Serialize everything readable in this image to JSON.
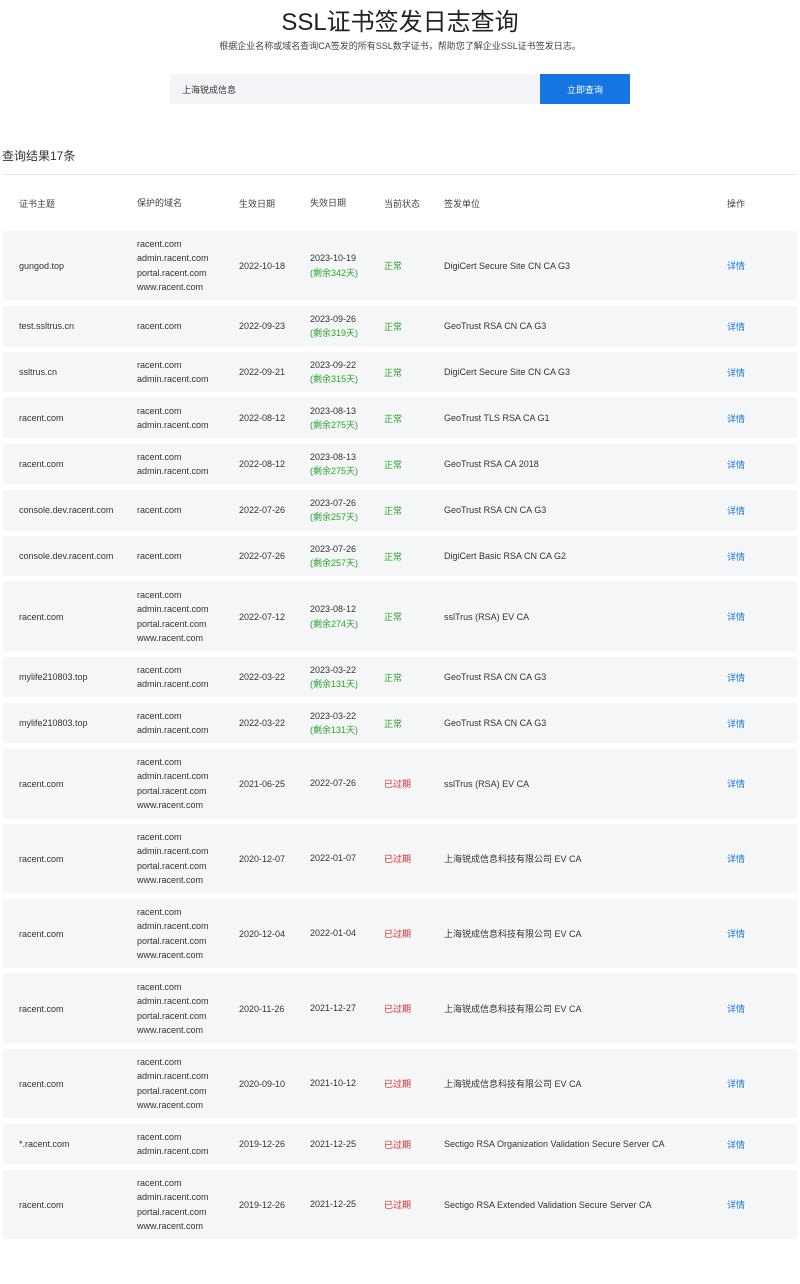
{
  "header": {
    "title": "SSL证书签发日志查询",
    "subtitle": "根据企业名称或域名查询CA签发的所有SSL数字证书，帮助您了解企业SSL证书签发日志。"
  },
  "search": {
    "value": "上海锐成信息",
    "button_label": "立即查询"
  },
  "result_count": "查询结果17条",
  "table": {
    "columns": [
      "证书主题",
      "保护的域名",
      "生效日期",
      "失效日期",
      "当前状态",
      "签发单位",
      "操作"
    ],
    "rows": [
      {
        "subject": "gungod.top",
        "domains": [
          "racent.com",
          "admin.racent.com",
          "portal.racent.com",
          "www.racent.com"
        ],
        "start": "2022-10-18",
        "end": "2023-10-19",
        "remain": "(剩余342天)",
        "status": "正常",
        "issuer": "DigiCert Secure Site CN CA G3",
        "action": "详情"
      },
      {
        "subject": "test.ssltrus.cn",
        "domains": [
          "racent.com"
        ],
        "start": "2022-09-23",
        "end": "2023-09-26",
        "remain": "(剩余319天)",
        "status": "正常",
        "issuer": "GeoTrust RSA CN CA G3",
        "action": "详情"
      },
      {
        "subject": "ssltrus.cn",
        "domains": [
          "racent.com",
          "admin.racent.com"
        ],
        "start": "2022-09-21",
        "end": "2023-09-22",
        "remain": "(剩余315天)",
        "status": "正常",
        "issuer": "DigiCert Secure Site CN CA G3",
        "action": "详情"
      },
      {
        "subject": "racent.com",
        "domains": [
          "racent.com",
          "admin.racent.com"
        ],
        "start": "2022-08-12",
        "end": "2023-08-13",
        "remain": "(剩余275天)",
        "status": "正常",
        "issuer": "GeoTrust TLS RSA CA G1",
        "action": "详情"
      },
      {
        "subject": "racent.com",
        "domains": [
          "racent.com",
          "admin.racent.com"
        ],
        "start": "2022-08-12",
        "end": "2023-08-13",
        "remain": "(剩余275天)",
        "status": "正常",
        "issuer": "GeoTrust RSA CA 2018",
        "action": "详情"
      },
      {
        "subject": "console.dev.racent.com",
        "domains": [
          "racent.com"
        ],
        "start": "2022-07-26",
        "end": "2023-07-26",
        "remain": "(剩余257天)",
        "status": "正常",
        "issuer": "GeoTrust RSA CN CA G3",
        "action": "详情"
      },
      {
        "subject": "console.dev.racent.com",
        "domains": [
          "racent.com"
        ],
        "start": "2022-07-26",
        "end": "2023-07-26",
        "remain": "(剩余257天)",
        "status": "正常",
        "issuer": "DigiCert Basic RSA CN CA G2",
        "action": "详情"
      },
      {
        "subject": "racent.com",
        "domains": [
          "racent.com",
          "admin.racent.com",
          "portal.racent.com",
          "www.racent.com"
        ],
        "start": "2022-07-12",
        "end": "2023-08-12",
        "remain": "(剩余274天)",
        "status": "正常",
        "issuer": "sslTrus (RSA) EV CA",
        "action": "详情"
      },
      {
        "subject": "mylife210803.top",
        "domains": [
          "racent.com",
          "admin.racent.com"
        ],
        "start": "2022-03-22",
        "end": "2023-03-22",
        "remain": "(剩余131天)",
        "status": "正常",
        "issuer": "GeoTrust RSA CN CA G3",
        "action": "详情"
      },
      {
        "subject": "mylife210803.top",
        "domains": [
          "racent.com",
          "admin.racent.com"
        ],
        "start": "2022-03-22",
        "end": "2023-03-22",
        "remain": "(剩余131天)",
        "status": "正常",
        "issuer": "GeoTrust RSA CN CA G3",
        "action": "详情"
      },
      {
        "subject": "racent.com",
        "domains": [
          "racent.com",
          "admin.racent.com",
          "portal.racent.com",
          "www.racent.com"
        ],
        "start": "2021-06-25",
        "end": "2022-07-26",
        "remain": "",
        "status": "已过期",
        "issuer": "sslTrus (RSA) EV CA",
        "action": "详情"
      },
      {
        "subject": "racent.com",
        "domains": [
          "racent.com",
          "admin.racent.com",
          "portal.racent.com",
          "www.racent.com"
        ],
        "start": "2020-12-07",
        "end": "2022-01-07",
        "remain": "",
        "status": "已过期",
        "issuer": "上海锐成信息科技有限公司 EV CA",
        "action": "详情"
      },
      {
        "subject": "racent.com",
        "domains": [
          "racent.com",
          "admin.racent.com",
          "portal.racent.com",
          "www.racent.com"
        ],
        "start": "2020-12-04",
        "end": "2022-01-04",
        "remain": "",
        "status": "已过期",
        "issuer": "上海锐成信息科技有限公司 EV CA",
        "action": "详情"
      },
      {
        "subject": "racent.com",
        "domains": [
          "racent.com",
          "admin.racent.com",
          "portal.racent.com",
          "www.racent.com"
        ],
        "start": "2020-11-26",
        "end": "2021-12-27",
        "remain": "",
        "status": "已过期",
        "issuer": "上海锐成信息科技有限公司 EV CA",
        "action": "详情"
      },
      {
        "subject": "racent.com",
        "domains": [
          "racent.com",
          "admin.racent.com",
          "portal.racent.com",
          "www.racent.com"
        ],
        "start": "2020-09-10",
        "end": "2021-10-12",
        "remain": "",
        "status": "已过期",
        "issuer": "上海锐成信息科技有限公司 EV CA",
        "action": "详情"
      },
      {
        "subject": "*.racent.com",
        "domains": [
          "racent.com",
          "admin.racent.com"
        ],
        "start": "2019-12-26",
        "end": "2021-12-25",
        "remain": "",
        "status": "已过期",
        "issuer": "Sectigo RSA Organization Validation Secure Server CA",
        "action": "详情"
      },
      {
        "subject": "racent.com",
        "domains": [
          "racent.com",
          "admin.racent.com",
          "portal.racent.com",
          "www.racent.com"
        ],
        "start": "2019-12-26",
        "end": "2021-12-25",
        "remain": "",
        "status": "已过期",
        "issuer": "Sectigo RSA Extended Validation Secure Server CA",
        "action": "详情"
      }
    ]
  }
}
